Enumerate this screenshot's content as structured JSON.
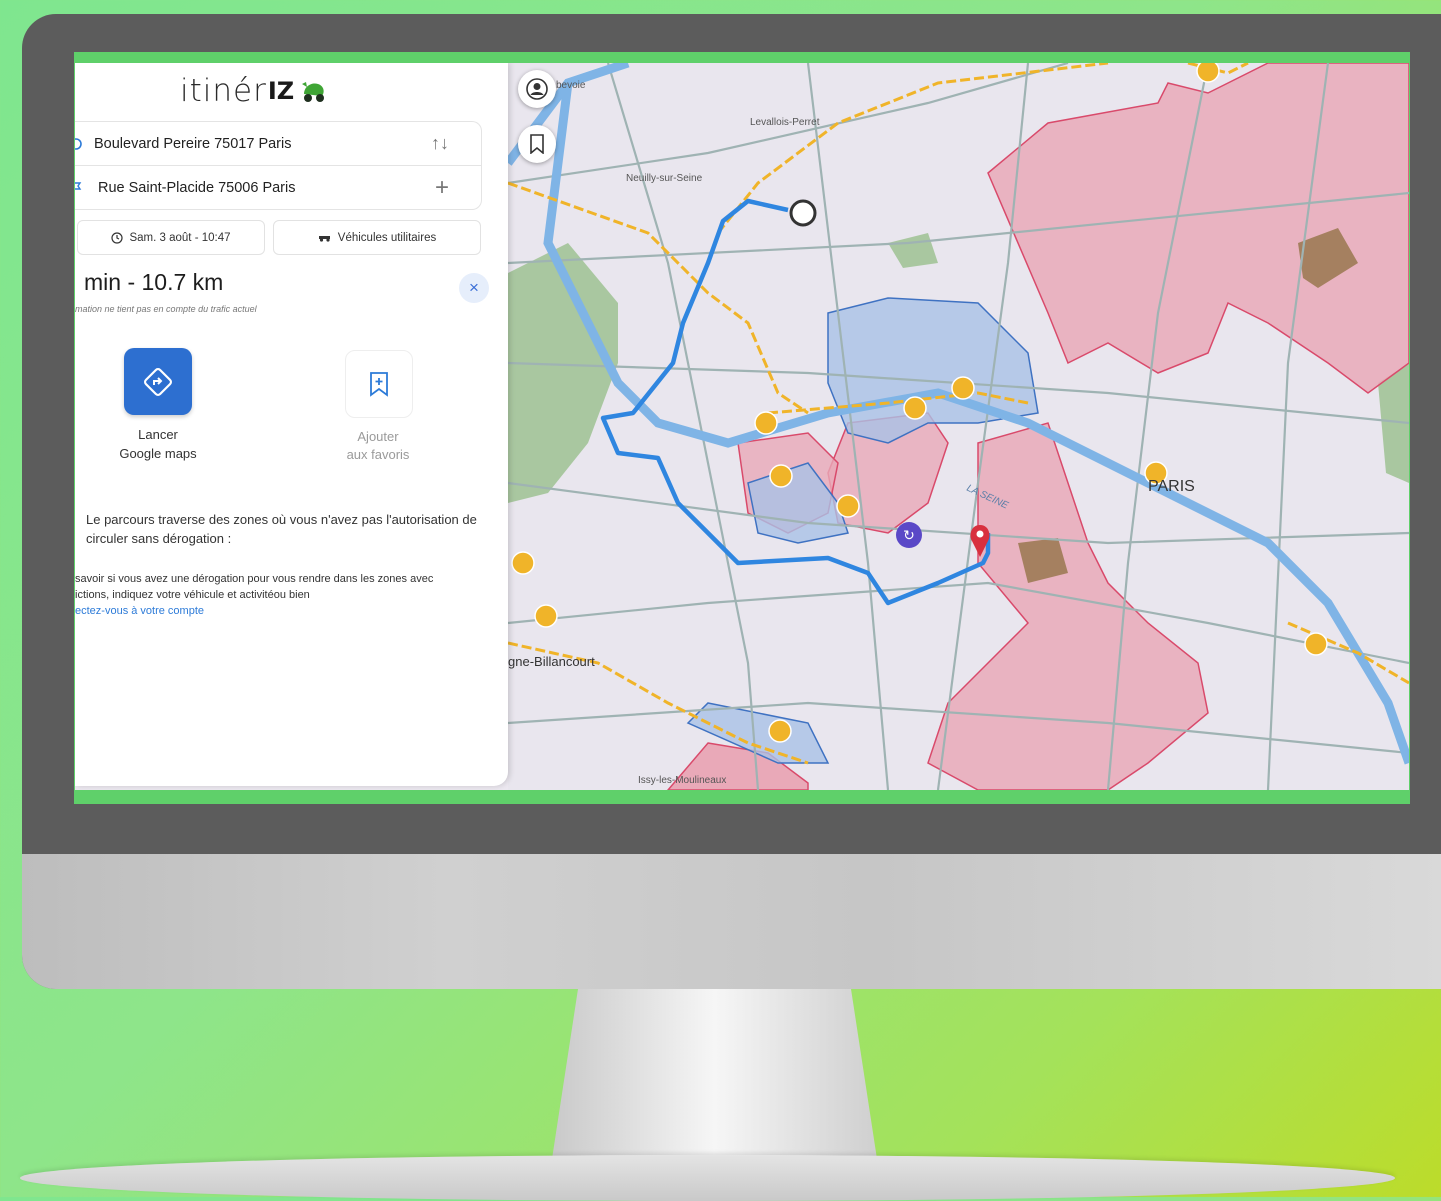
{
  "app": {
    "logo_text": "itinér",
    "logo_mark": "IZ",
    "brand_green": "#3fa535",
    "accent_blue": "#2d6fd0"
  },
  "route": {
    "origin": "Boulevard Pereire 75017 Paris",
    "destination": "Rue Saint-Placide 75006 Paris",
    "swap_icon": "↑↓",
    "add_icon": "+"
  },
  "options": {
    "datetime": "Sam. 3 août - 10:47",
    "vehicle": "Véhicules utilitaires"
  },
  "summary": {
    "duration": "min - 10.7 km",
    "close_icon": "×",
    "note": "mation ne tient pas en compte du trafic actuel"
  },
  "actions": {
    "launch_line1": "Lancer",
    "launch_line2": "Google maps",
    "fav_line1": "Ajouter",
    "fav_line2": "aux favoris"
  },
  "warning": {
    "text": "Le parcours traverse des zones où vous n'avez pas l'autorisation de circuler sans dérogation :"
  },
  "info": {
    "line1": "savoir si vous avez une dérogation pour vous rendre dans les zones avec",
    "line2": "ictions, indiquez votre véhicule et activitéou bien",
    "link": "ectez-vous à votre compte"
  },
  "map": {
    "labels": {
      "courbevoie": "bevoie",
      "levallois": "Levallois-Perret",
      "neuilly": "Neuilly-sur-Seine",
      "paris": "PARIS",
      "seine": "LA SEINE",
      "boulogne": "gne-Billancourt",
      "issy": "Issy-les-Moulineaux"
    },
    "icons": [
      "account-icon",
      "bookmark-icon",
      "route-start-icon",
      "destination-pin-icon",
      "restriction-zone-icon"
    ],
    "colors": {
      "route": "#2f86e0",
      "restricted_zone": "#e8a3b5",
      "low_emission_zone": "#8fb0dc",
      "orange_roads": "#f0b429"
    }
  }
}
